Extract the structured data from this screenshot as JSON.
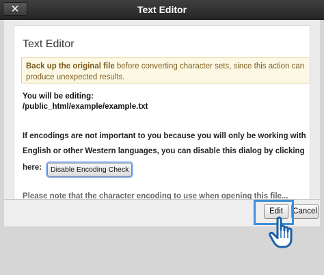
{
  "window": {
    "title": "Text Editor",
    "close_icon": "close-icon",
    "close_glyph": "✕"
  },
  "panel": {
    "title": "Text Editor",
    "warning": {
      "bold": "Back up the original file",
      "rest": " before converting character sets, since this action can produce unexpected results."
    },
    "editing_label": "You will be editing:",
    "editing_path": "/public_html/example/example.txt",
    "encoding_text": "If encodings are not important to you because you will only be working with English or other Western languages, you can disable this dialog by clicking",
    "here_label": "here:",
    "disable_button": "Disable Encoding Check",
    "cut_line": "Please note that the character encoding to use when opening this file..."
  },
  "footer": {
    "edit_label": "Edit",
    "cancel_label": "Cancel"
  },
  "cursor": {
    "icon": "hand-pointer-icon"
  },
  "colors": {
    "titlebar": "#2e2e2e",
    "warning_bg": "#fcf8e3",
    "highlight": "#3d8fd6"
  }
}
